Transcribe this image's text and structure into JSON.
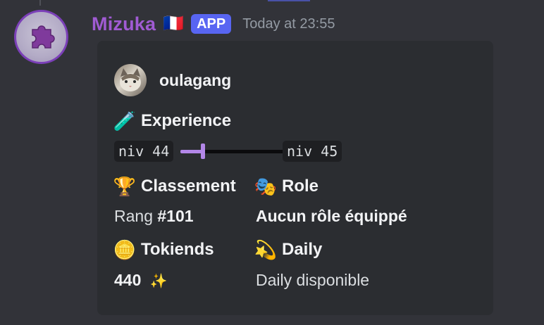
{
  "message": {
    "username": "Mizuka",
    "flag_icon": "🇫🇷",
    "app_badge": "APP",
    "timestamp": "Today at 23:55",
    "avatar_icon": "puzzle-piece-icon"
  },
  "embed": {
    "author": {
      "name": "oulagang",
      "avatar_icon": "cat-photo"
    },
    "experience": {
      "emoji": "🧪",
      "title": "Experience",
      "current_level": "niv 44",
      "next_level": "niv 45",
      "progress": 0.15,
      "bar_color": "#b387e8"
    },
    "ranking": {
      "emoji": "🏆",
      "title": "Classement",
      "value_prefix": "Rang",
      "value": "#101"
    },
    "role": {
      "emoji": "🎭",
      "title": "Role",
      "value": "Aucun rôle équippé"
    },
    "tokiends": {
      "emoji": "🪙",
      "title": "Tokiends",
      "value": "440",
      "icon": "✨"
    },
    "daily": {
      "emoji": "💫",
      "title": "Daily",
      "value": "Daily disponible"
    }
  },
  "colors": {
    "username": "#a05bd3",
    "app_badge": "#5865f2",
    "embed_bg": "#2b2d31",
    "page_bg": "#323339"
  }
}
